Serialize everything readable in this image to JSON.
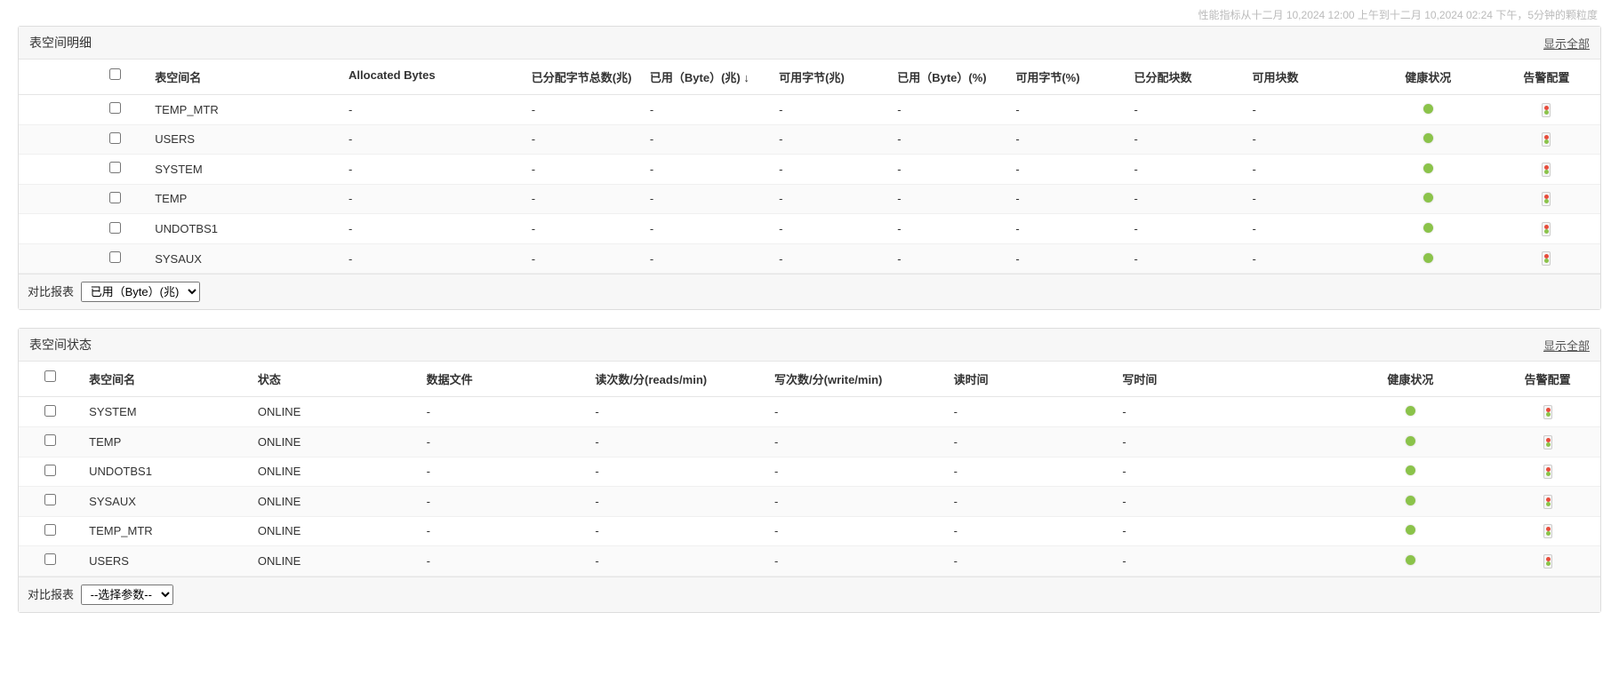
{
  "top_info": "性能指标从十二月 10,2024 12:00 上午到十二月 10,2024 02:24 下午，5分钟的颗粒度",
  "show_all_label": "显示全部",
  "compare_label": "对比报表",
  "panel1": {
    "title": "表空间明细",
    "headers": {
      "name": "表空间名",
      "alloc": "Allocated Bytes",
      "alloc_total": "已分配字节总数(兆)",
      "used_mb": "已用（Byte）(兆)",
      "sort_ind": "↓",
      "avail_mb": "可用字节(兆)",
      "used_pct": "已用（Byte）(%)",
      "avail_pct": "可用字节(%)",
      "alloc_blocks": "已分配块数",
      "avail_blocks": "可用块数",
      "health": "健康状况",
      "alarm": "告警配置"
    },
    "rows": [
      {
        "name": "TEMP_MTR",
        "alloc": "-",
        "alloc_total": "-",
        "used_mb": "-",
        "avail_mb": "-",
        "used_pct": "-",
        "avail_pct": "-",
        "alloc_blocks": "-",
        "avail_blocks": "-"
      },
      {
        "name": "USERS",
        "alloc": "-",
        "alloc_total": "-",
        "used_mb": "-",
        "avail_mb": "-",
        "used_pct": "-",
        "avail_pct": "-",
        "alloc_blocks": "-",
        "avail_blocks": "-"
      },
      {
        "name": "SYSTEM",
        "alloc": "-",
        "alloc_total": "-",
        "used_mb": "-",
        "avail_mb": "-",
        "used_pct": "-",
        "avail_pct": "-",
        "alloc_blocks": "-",
        "avail_blocks": "-"
      },
      {
        "name": "TEMP",
        "alloc": "-",
        "alloc_total": "-",
        "used_mb": "-",
        "avail_mb": "-",
        "used_pct": "-",
        "avail_pct": "-",
        "alloc_blocks": "-",
        "avail_blocks": "-"
      },
      {
        "name": "UNDOTBS1",
        "alloc": "-",
        "alloc_total": "-",
        "used_mb": "-",
        "avail_mb": "-",
        "used_pct": "-",
        "avail_pct": "-",
        "alloc_blocks": "-",
        "avail_blocks": "-"
      },
      {
        "name": "SYSAUX",
        "alloc": "-",
        "alloc_total": "-",
        "used_mb": "-",
        "avail_mb": "-",
        "used_pct": "-",
        "avail_pct": "-",
        "alloc_blocks": "-",
        "avail_blocks": "-"
      }
    ],
    "select_value": "已用（Byte）(兆)"
  },
  "panel2": {
    "title": "表空间状态",
    "headers": {
      "name": "表空间名",
      "status": "状态",
      "datafile": "数据文件",
      "reads": "读次数/分(reads/min)",
      "writes": "写次数/分(write/min)",
      "read_time": "读时间",
      "write_time": "写时间",
      "health": "健康状况",
      "alarm": "告警配置"
    },
    "rows": [
      {
        "name": "SYSTEM",
        "status": "ONLINE",
        "datafile": "-",
        "reads": "-",
        "writes": "-",
        "read_time": "-",
        "write_time": "-"
      },
      {
        "name": "TEMP",
        "status": "ONLINE",
        "datafile": "-",
        "reads": "-",
        "writes": "-",
        "read_time": "-",
        "write_time": "-"
      },
      {
        "name": "UNDOTBS1",
        "status": "ONLINE",
        "datafile": "-",
        "reads": "-",
        "writes": "-",
        "read_time": "-",
        "write_time": "-"
      },
      {
        "name": "SYSAUX",
        "status": "ONLINE",
        "datafile": "-",
        "reads": "-",
        "writes": "-",
        "read_time": "-",
        "write_time": "-"
      },
      {
        "name": "TEMP_MTR",
        "status": "ONLINE",
        "datafile": "-",
        "reads": "-",
        "writes": "-",
        "read_time": "-",
        "write_time": "-"
      },
      {
        "name": "USERS",
        "status": "ONLINE",
        "datafile": "-",
        "reads": "-",
        "writes": "-",
        "read_time": "-",
        "write_time": "-"
      }
    ],
    "select_value": "--选择参数--"
  }
}
